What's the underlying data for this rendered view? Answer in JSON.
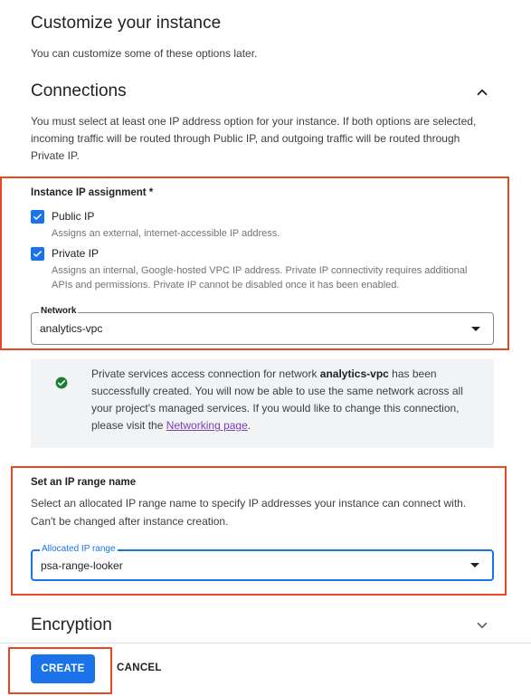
{
  "page": {
    "title": "Customize your instance",
    "subtitle": "You can customize some of these options later."
  },
  "connections": {
    "title": "Connections",
    "description": "You must select at least one IP address option for your instance. If both options are selected, incoming traffic will be routed through Public IP, and outgoing traffic will be routed through Private IP.",
    "ip_assignment_label": "Instance IP assignment *",
    "public_ip": {
      "label": "Public IP",
      "description": "Assigns an external, internet-accessible IP address.",
      "checked": true
    },
    "private_ip": {
      "label": "Private IP",
      "description": "Assigns an internal, Google-hosted VPC IP address. Private IP connectivity requires additional APIs and permissions. Private IP cannot be disabled once it has been enabled.",
      "checked": true
    },
    "network": {
      "legend": "Network",
      "value": "analytics-vpc"
    }
  },
  "notice": {
    "text_before": "Private services access connection for network ",
    "network_name": "analytics-vpc",
    "text_after": " has been successfully created. You will now be able to use the same network across all your project's managed services. If you would like to change this connection, please visit the ",
    "link_text": "Networking page",
    "text_end": ".",
    "icon": "check-circle-icon",
    "icon_color": "#188038"
  },
  "ip_range": {
    "title": "Set an IP range name",
    "description": "Select an allocated IP range name to specify IP addresses your instance can connect with. Can't be changed after instance creation.",
    "legend": "Allocated IP range",
    "value": "psa-range-looker"
  },
  "encryption": {
    "title": "Encryption"
  },
  "actions": {
    "create_label": "CREATE",
    "cancel_label": "CANCEL"
  },
  "colors": {
    "accent": "#1a73e8",
    "highlight": "#e8471f",
    "success": "#188038",
    "link": "#7b3fb5"
  }
}
